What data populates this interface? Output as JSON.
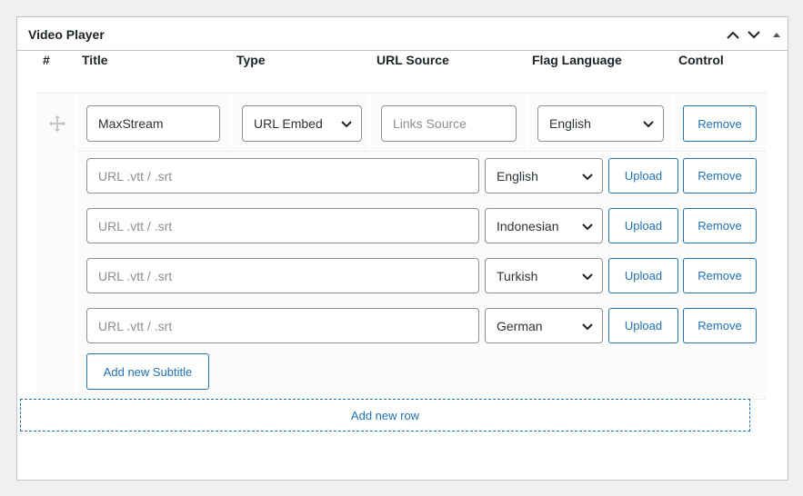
{
  "panel": {
    "title": "Video Player"
  },
  "table": {
    "columns": [
      "#",
      "Title",
      "Type",
      "URL Source",
      "Flag Language",
      "Control"
    ]
  },
  "row": {
    "title_value": "MaxStream",
    "type_value": "URL Embed",
    "url_source_placeholder": "Links Source",
    "flag_language_value": "English",
    "remove_label": "Remove"
  },
  "subtitles": [
    {
      "url_placeholder": "URL .vtt / .srt",
      "language": "English",
      "upload_label": "Upload",
      "remove_label": "Remove"
    },
    {
      "url_placeholder": "URL .vtt / .srt",
      "language": "Indonesian",
      "upload_label": "Upload",
      "remove_label": "Remove"
    },
    {
      "url_placeholder": "URL .vtt / .srt",
      "language": "Turkish",
      "upload_label": "Upload",
      "remove_label": "Remove"
    },
    {
      "url_placeholder": "URL .vtt / .srt",
      "language": "German",
      "upload_label": "Upload",
      "remove_label": "Remove"
    }
  ],
  "add_subtitle_label": "Add new Subtitle",
  "add_row_label": "Add new row",
  "colors": {
    "accent": "#2271b1",
    "border": "#8c8f94",
    "placeholder": "#8c8f94",
    "panel_border": "#c3c4c7",
    "page_bg": "#f0f0f1"
  },
  "icons": {
    "collapse_up": "chevron-up-icon",
    "collapse_down": "chevron-down-icon",
    "toggle": "triangle-up-icon",
    "drag": "move-icon",
    "select": "chevron-down-icon"
  }
}
